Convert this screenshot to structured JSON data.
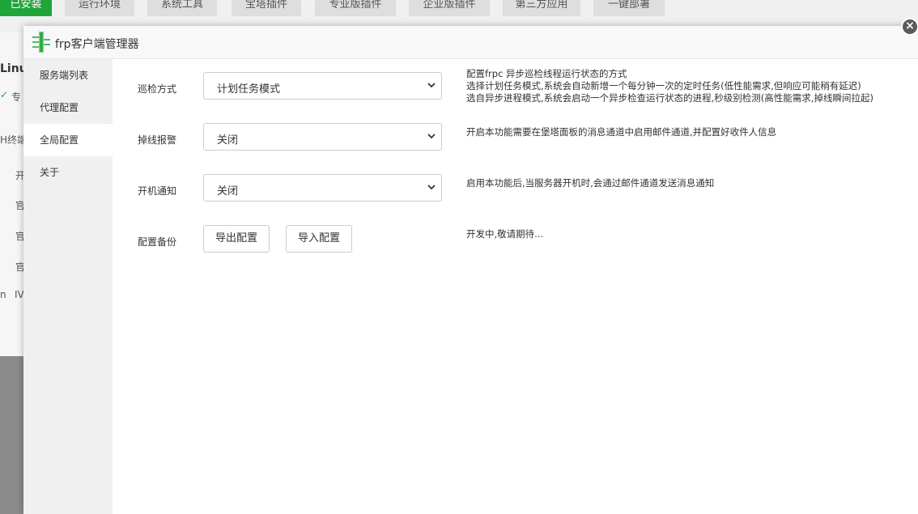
{
  "background": {
    "tabs": [
      "已安装",
      "运行环境",
      "系统工具",
      "宝塔插件",
      "专业版插件",
      "企业版插件",
      "第三方应用",
      "一键部署"
    ],
    "fragments": {
      "linux": "Linu",
      "check_mark": "✓",
      "pro": "专",
      "terminal": "H终端",
      "kai": "开",
      "guan1": "官",
      "guan2": "官",
      "guan3": "官",
      "n": "n",
      "iv": "IV"
    }
  },
  "modal": {
    "title": "frp客户端管理器",
    "close_symbol": "×",
    "sidebar": [
      {
        "label": "服务端列表",
        "active": false
      },
      {
        "label": "代理配置",
        "active": false
      },
      {
        "label": "全局配置",
        "active": true
      },
      {
        "label": "关于",
        "active": false
      }
    ],
    "settings": {
      "patrol": {
        "label": "巡检方式",
        "value": "计划任务模式",
        "help": [
          "配置frpc 异步巡检线程运行状态的方式",
          "选择计划任务模式,系统会自动新增一个每分钟一次的定时任务(低性能需求,但响应可能稍有延迟)",
          "选自异步进程模式,系统会启动一个异步检查运行状态的进程,秒级别检测(高性能需求,掉线瞬间拉起)"
        ]
      },
      "offline_alert": {
        "label": "掉线报警",
        "value": "关闭",
        "help": "开启本功能需要在堡塔面板的消息通道中启用邮件通道,并配置好收件人信息"
      },
      "boot_notify": {
        "label": "开机通知",
        "value": "关闭",
        "help": "启用本功能后,当服务器开机时,会通过邮件通道发送消息通知"
      },
      "backup": {
        "label": "配置备份",
        "export_label": "导出配置",
        "import_label": "导入配置",
        "help": "开发中,敬请期待..."
      }
    }
  },
  "colors": {
    "accent": "#20a53a",
    "sidebar_bg": "#f0f0f0",
    "border": "#cccccc"
  }
}
